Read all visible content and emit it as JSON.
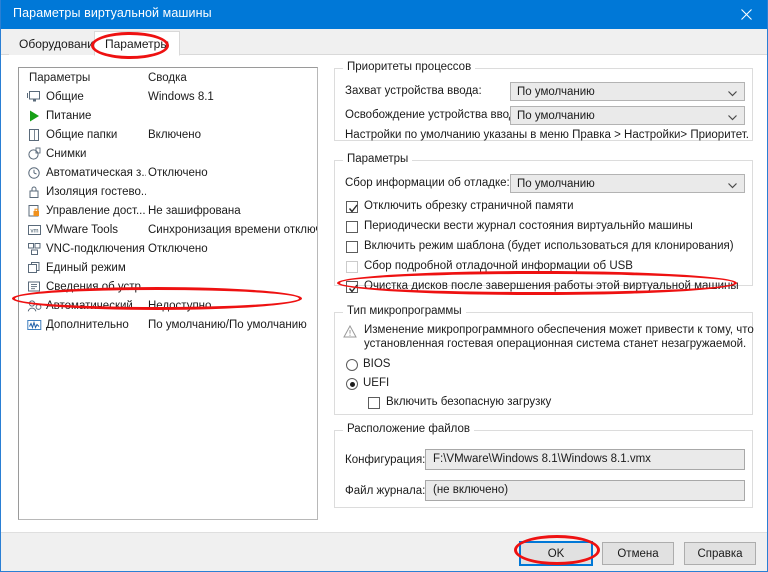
{
  "window": {
    "title": "Параметры виртуальной машины",
    "close_icon": "close-icon",
    "titlebar_color": "#0078d7"
  },
  "tabs": [
    {
      "label": "Оборудование",
      "selected": false
    },
    {
      "label": "Параметры",
      "selected": true
    }
  ],
  "settings_list": {
    "headers": {
      "name": "Параметры",
      "summary": "Сводка"
    },
    "rows": [
      {
        "icon": "monitor-icon",
        "label": "Общие",
        "summary": "Windows 8.1"
      },
      {
        "icon": "play-icon",
        "label": "Питание",
        "summary": ""
      },
      {
        "icon": "shared-folder-icon",
        "label": "Общие папки",
        "summary": "Включено"
      },
      {
        "icon": "snapshot-icon",
        "label": "Снимки",
        "summary": ""
      },
      {
        "icon": "clock-icon",
        "label": "Автоматическая з...",
        "summary": "Отключено"
      },
      {
        "icon": "lock-icon",
        "label": "Изоляция гостево...",
        "summary": ""
      },
      {
        "icon": "access-control-icon",
        "label": "Управление дост...",
        "summary": "Не зашифрована"
      },
      {
        "icon": "vmware-tools-icon",
        "label": "VMware Tools",
        "summary": "Синхронизация времени отключена"
      },
      {
        "icon": "vnc-icon",
        "label": "VNC-подключения",
        "summary": "Отключено"
      },
      {
        "icon": "unity-icon",
        "label": "Единый режим",
        "summary": ""
      },
      {
        "icon": "device-info-icon",
        "label": "Сведения об устр...",
        "summary": ""
      },
      {
        "icon": "autologin-icon",
        "label": "Автоматический ...",
        "summary": "Недоступно"
      },
      {
        "icon": "advanced-icon",
        "label": "Дополнительно",
        "summary": "По умолчанию/По умолчанию"
      }
    ]
  },
  "process_priority": {
    "title": "Приоритеты процессов",
    "grab_label": "Захват устройства ввода:",
    "grab_value": "По умолчанию",
    "release_label": "Освобождение устройства ввода:",
    "release_value": "По умолчанию",
    "hint": "Настройки по умолчанию указаны в меню Правка > Настройки> Приоритет."
  },
  "settings_group": {
    "title": "Параметры",
    "debug_label": "Сбор информации об отладке:",
    "debug_value": "По умолчанию",
    "checkboxes": [
      {
        "label": "Отключить обрезку страничной памяти",
        "checked": true,
        "disabled": false
      },
      {
        "label": "Периодически вести журнал состояния виртуальнйо машины",
        "checked": false,
        "disabled": false
      },
      {
        "label": "Включить режим шаблона (будет использоваться для клонирования)",
        "checked": false,
        "disabled": false
      },
      {
        "label": "Сбор подробной отладочной информации об USB",
        "checked": false,
        "disabled": true
      },
      {
        "label": "Очистка дисков после завершения работы этой виртуальной машины",
        "checked": true,
        "disabled": false
      }
    ]
  },
  "firmware": {
    "title": "Тип микропрограммы",
    "warning_icon": "warning-triangle-icon",
    "warning_line1": "Изменение микропрограммного обеспечения может привести к тому, что",
    "warning_line2": "установленная гостевая операционная система станет незагружаемой.",
    "options": [
      {
        "label": "BIOS",
        "selected": false
      },
      {
        "label": "UEFI",
        "selected": true
      }
    ],
    "secure_boot": {
      "label": "Включить безопасную загрузку",
      "checked": false
    }
  },
  "file_location": {
    "title": "Расположение файлов",
    "config_label": "Конфигурация:",
    "config_value": "F:\\VMware\\Windows 8.1\\Windows 8.1.vmx",
    "log_label": "Файл журнала:",
    "log_value": "(не включено)"
  },
  "footer": {
    "ok": "OK",
    "cancel": "Отмена",
    "help": "Справка"
  },
  "annotation_color": "#ee1111"
}
